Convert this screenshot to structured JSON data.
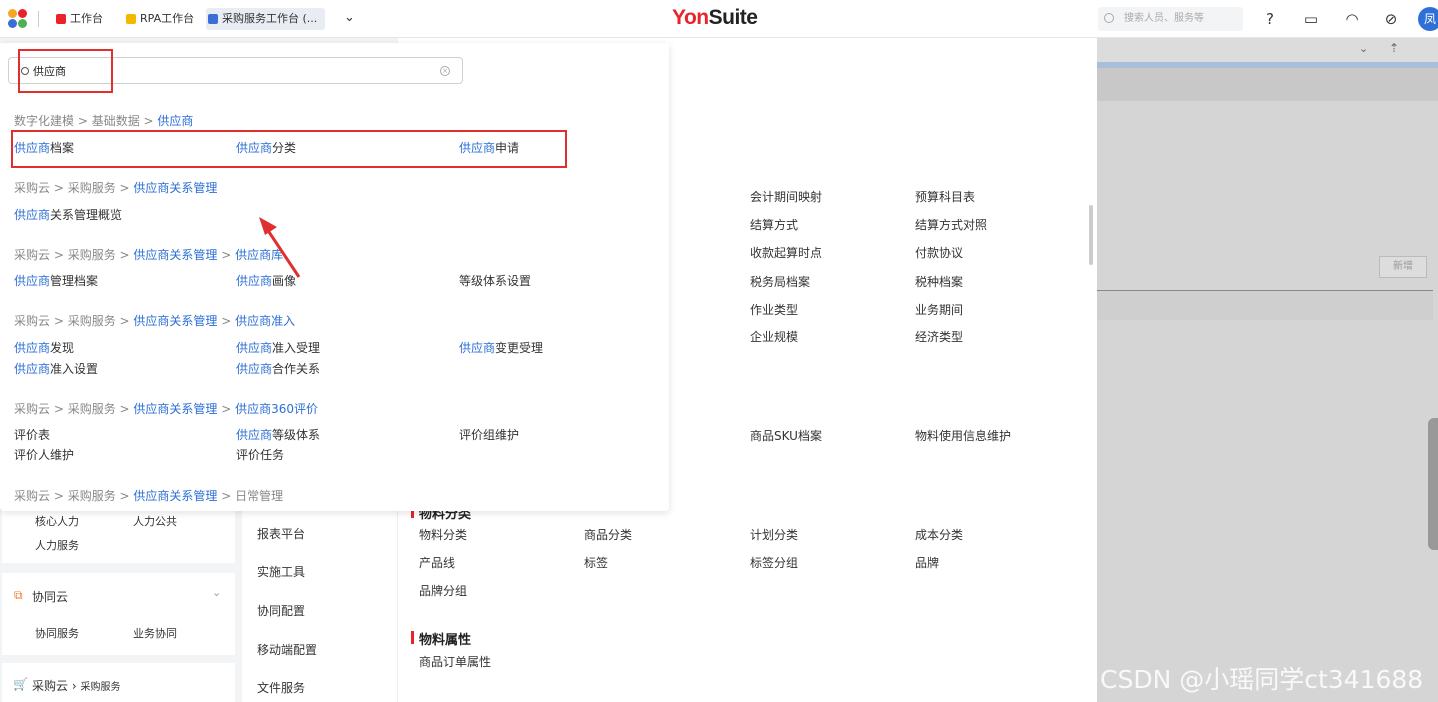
{
  "topbar": {
    "tabs": [
      {
        "label": "工作台",
        "color": "#e8232a"
      },
      {
        "label": "RPA工作台",
        "color": "#f5b800"
      },
      {
        "label": "采购服务工作台 (...",
        "color": "#3a6fd8"
      }
    ],
    "brand_part1": "Yon",
    "brand_part2": "Suite",
    "search_placeholder": "搜索人员、服务等",
    "avatar_text": "凤"
  },
  "popup": {
    "search_value": "供应商",
    "groups": [
      {
        "crumb": [
          "数字化建模",
          "基础数据",
          "供应商"
        ],
        "items": [
          [
            "供应商",
            "档案"
          ],
          [
            "供应商",
            "分类"
          ],
          [
            "供应商",
            "申请"
          ]
        ]
      },
      {
        "crumb": [
          "采购云",
          "采购服务",
          "供应商关系管理"
        ],
        "items": [
          [
            "供应商",
            "关系管理概览"
          ]
        ]
      },
      {
        "crumb": [
          "采购云",
          "采购服务",
          "供应商关系管理",
          "供应商库"
        ],
        "items": [
          [
            "供应商",
            "管理档案"
          ],
          [
            "供应商",
            "画像"
          ],
          [
            "",
            "等级体系设置"
          ]
        ]
      },
      {
        "crumb": [
          "采购云",
          "采购服务",
          "供应商关系管理",
          "供应商准入"
        ],
        "items": [
          [
            "供应商",
            "发现"
          ],
          [
            "供应商",
            "准入受理"
          ],
          [
            "供应商",
            "变更受理"
          ],
          [
            "供应商",
            "准入设置"
          ],
          [
            "供应商",
            "合作关系"
          ]
        ]
      },
      {
        "crumb": [
          "采购云",
          "采购服务",
          "供应商关系管理",
          "供应商360评价"
        ],
        "items": [
          [
            "",
            "评价表"
          ],
          [
            "供应商",
            "等级体系"
          ],
          [
            "",
            "评价组维护"
          ],
          [
            "",
            "评价人维护"
          ],
          [
            "",
            "评价任务"
          ]
        ]
      },
      {
        "crumb": [
          "采购云",
          "采购服务",
          "供应商关系管理",
          "日常管理"
        ],
        "items": []
      }
    ]
  },
  "main": {
    "items_a": [
      "会计期间映射",
      "预算科目表",
      "结算方式",
      "结算方式对照",
      "收款起算时点",
      "付款协议",
      "税务局档案",
      "税种档案",
      "作业类型",
      "业务期间",
      "企业规模",
      "经济类型"
    ],
    "items_b": [
      "商品SKU档案",
      "物料使用信息维护"
    ],
    "heading_partial": "物料分类",
    "cat_items": [
      "物料分类",
      "商品分类",
      "计划分类",
      "成本分类",
      "产品线",
      "标签",
      "标签分组",
      "品牌",
      "品牌分组"
    ],
    "heading_attr": "物料属性",
    "attr_items": [
      "商品订单属性"
    ]
  },
  "left": {
    "hr_items": [
      "核心人力",
      "人力公共",
      "人力服务"
    ],
    "collab_title": "协同云",
    "collab_items": [
      "协同服务",
      "业务协同"
    ],
    "purchase_title": "采购云",
    "purchase_sub": "采购服务"
  },
  "mid": {
    "items": [
      "报表平台",
      "实施工具",
      "协同配置",
      "移动端配置",
      "文件服务"
    ]
  },
  "right_panel": {
    "new_button": "新增"
  },
  "watermark": "CSDN @小瑶同学ct341688"
}
